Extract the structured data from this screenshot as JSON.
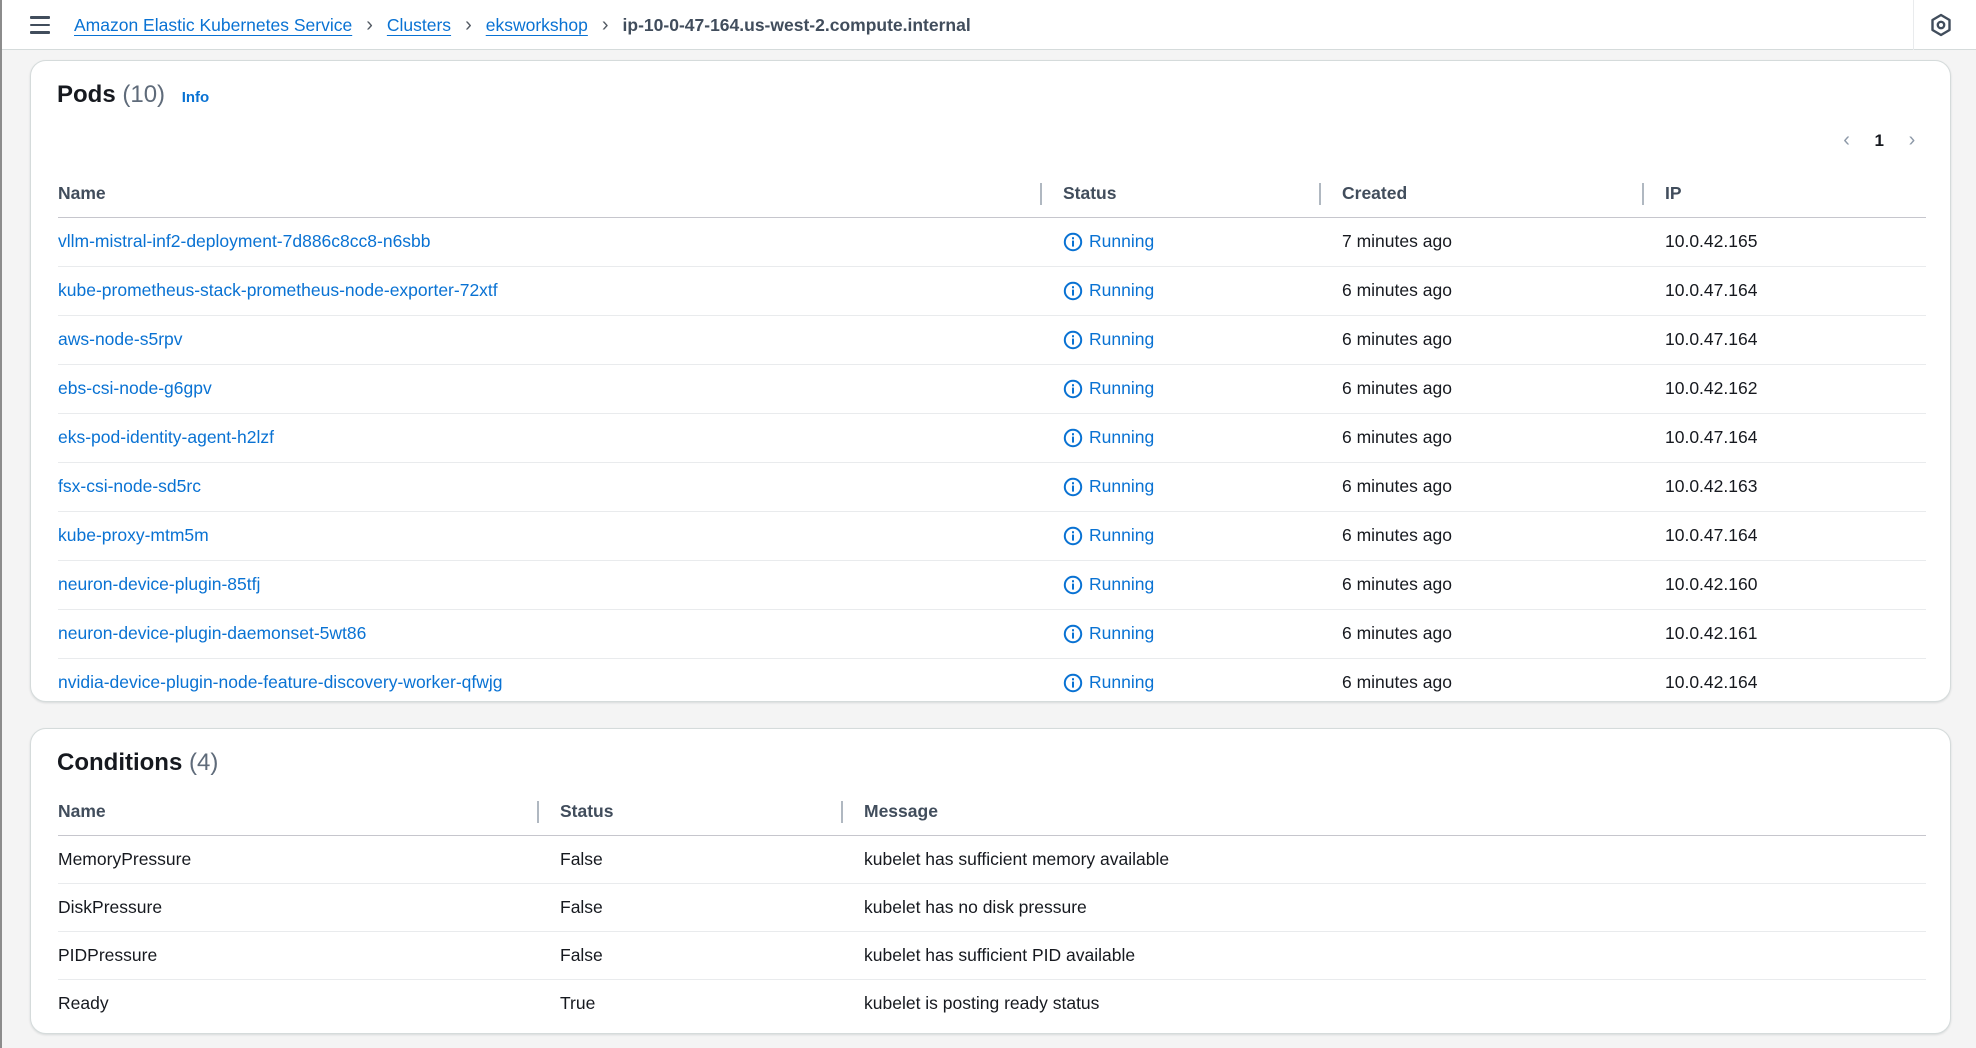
{
  "breadcrumb": {
    "items": [
      {
        "label": "Amazon Elastic Kubernetes Service"
      },
      {
        "label": "Clusters"
      },
      {
        "label": "eksworkshop"
      }
    ],
    "current": "ip-10-0-47-164.us-west-2.compute.internal"
  },
  "pods": {
    "title": "Pods",
    "count": "(10)",
    "info": "Info",
    "pagination": {
      "current_page": "1"
    },
    "columns": {
      "name": "Name",
      "status": "Status",
      "created": "Created",
      "ip": "IP"
    },
    "rows": [
      {
        "name": "vllm-mistral-inf2-deployment-7d886c8cc8-n6sbb",
        "status": "Running",
        "created": "7 minutes ago",
        "ip": "10.0.42.165"
      },
      {
        "name": "kube-prometheus-stack-prometheus-node-exporter-72xtf",
        "status": "Running",
        "created": "6 minutes ago",
        "ip": "10.0.47.164"
      },
      {
        "name": "aws-node-s5rpv",
        "status": "Running",
        "created": "6 minutes ago",
        "ip": "10.0.47.164"
      },
      {
        "name": "ebs-csi-node-g6gpv",
        "status": "Running",
        "created": "6 minutes ago",
        "ip": "10.0.42.162"
      },
      {
        "name": "eks-pod-identity-agent-h2lzf",
        "status": "Running",
        "created": "6 minutes ago",
        "ip": "10.0.47.164"
      },
      {
        "name": "fsx-csi-node-sd5rc",
        "status": "Running",
        "created": "6 minutes ago",
        "ip": "10.0.42.163"
      },
      {
        "name": "kube-proxy-mtm5m",
        "status": "Running",
        "created": "6 minutes ago",
        "ip": "10.0.47.164"
      },
      {
        "name": "neuron-device-plugin-85tfj",
        "status": "Running",
        "created": "6 minutes ago",
        "ip": "10.0.42.160"
      },
      {
        "name": "neuron-device-plugin-daemonset-5wt86",
        "status": "Running",
        "created": "6 minutes ago",
        "ip": "10.0.42.161"
      },
      {
        "name": "nvidia-device-plugin-node-feature-discovery-worker-qfwjg",
        "status": "Running",
        "created": "6 minutes ago",
        "ip": "10.0.42.164"
      }
    ]
  },
  "conditions": {
    "title": "Conditions",
    "count": "(4)",
    "columns": {
      "name": "Name",
      "status": "Status",
      "message": "Message"
    },
    "rows": [
      {
        "name": "MemoryPressure",
        "status": "False",
        "message": "kubelet has sufficient memory available"
      },
      {
        "name": "DiskPressure",
        "status": "False",
        "message": "kubelet has no disk pressure"
      },
      {
        "name": "PIDPressure",
        "status": "False",
        "message": "kubelet has sufficient PID available"
      },
      {
        "name": "Ready",
        "status": "True",
        "message": "kubelet is posting ready status"
      }
    ]
  },
  "icons": {
    "menu": "hamburger-menu-icon",
    "status": "info-circle-icon",
    "settings": "settings-hex-icon"
  },
  "colors": {
    "link": "#0972d3",
    "text": "#16191f"
  }
}
